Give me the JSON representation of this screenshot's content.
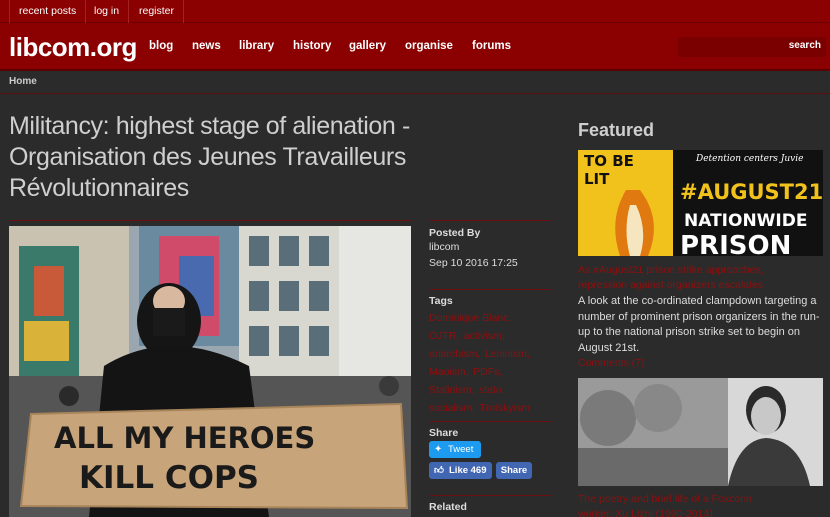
{
  "topbar": {
    "links": [
      "recent posts",
      "log in",
      "register"
    ]
  },
  "header": {
    "logo": "libcom.org",
    "nav": [
      "blog",
      "news",
      "library",
      "history",
      "gallery",
      "organise",
      "forums"
    ],
    "search_label": "search"
  },
  "breadcrumb": {
    "home": "Home"
  },
  "article": {
    "title_line1": "Militancy: highest stage of alienation -",
    "title_line2": "Organisation des Jeunes Travailleurs",
    "title_line3": "Révolutionnaires",
    "sign_text_line1": "ALL MY HEROES",
    "sign_text_line2": "KILL COPS"
  },
  "meta": {
    "posted_by_heading": "Posted By",
    "author": "libcom",
    "date": "Sep 10 2016 17:25",
    "tags_heading": "Tags",
    "tags": [
      "Dominique Blanc,",
      "OJTR,",
      "activism,",
      "anarchism,",
      "Leninism,",
      "Maoism,",
      "PDFs,",
      "Stalinism,",
      "stato",
      "socialism,",
      "Trotskyism"
    ],
    "share_heading": "Share",
    "tweet_label": "Tweet",
    "like_label": "Like 469",
    "share_label": "Share",
    "related_heading": "Related"
  },
  "featured": {
    "heading": "Featured",
    "poster_text_left_line1": "TO BE",
    "poster_text_left_line2": "LIT",
    "poster_text_top": "Detention centers Juvie",
    "poster_text_line1": "#AUGUST21",
    "poster_text_line2": "NATIONWIDE",
    "poster_text_line3": "PRISON",
    "item1_link_line1": "As #August21 prison strike approaches,",
    "item1_link_line2": "repression against organizers escalates",
    "item1_text": "A look at the co-ordinated clampdown targeting a number of prominent prison organizers in the run-up to the national prison strike set to begin on August 21st.",
    "item1_comments": "Comments (7)",
    "item2_link_line1": "The poetry and brief life of a Foxconn",
    "item2_link_line2": "worker: Xu Lizhi (1990-2014)"
  },
  "colors": {
    "brand": "#8b0000",
    "link": "#8b1010",
    "background": "#2b2b2b"
  }
}
